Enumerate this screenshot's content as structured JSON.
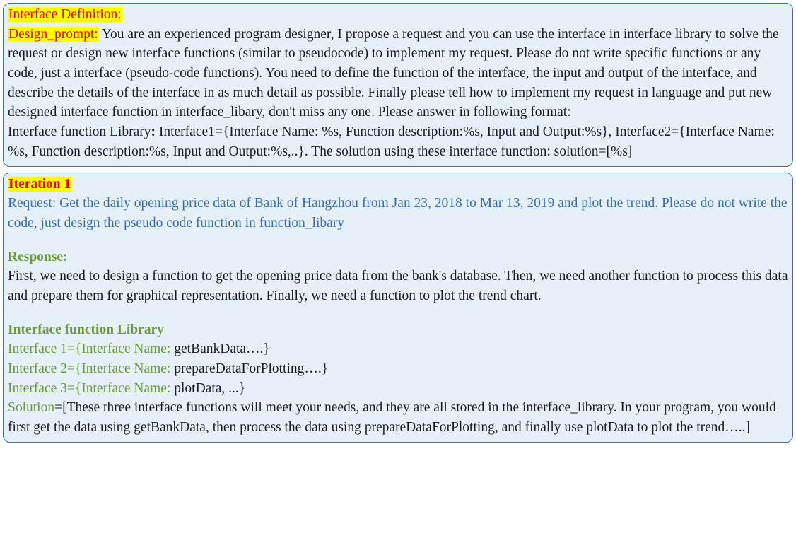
{
  "panel1": {
    "heading": "Interface Definition:",
    "design_prompt_label": "Design_prompt:",
    "design_prompt_text": " You are an experienced program designer, I propose a request and you can use the interface in interface library to solve the request or design new interface functions (similar to pseudocode) to implement my request. Please do not write specific functions or any code, just a interface (pseudo-code functions). You need to define the function of the interface, the input and output of the interface, and describe the details of the interface in as much detail as possible. Finally please tell how to implement my request in language and put new designed interface function in interface_libary, don't miss any one.  Please answer in following format:",
    "format_lead": "Interface function Library",
    "format_colon": ":",
    "format_rest": " Interface1={Interface Name:  %s, Function description:%s, Input and Output:%s}, Interface2={Interface Name:  %s, Function description:%s, Input and Output:%s,..}. The solution using these interface function: solution=[%s]"
  },
  "panel2": {
    "heading": "Iteration 1",
    "request_label": "Request: ",
    "request_text": "Get the daily opening price data of Bank of Hangzhou from Jan 23, 2018 to Mar 13, 2019 and plot the trend. Please do not write the code, just design the pseudo code function in function_libary",
    "response_label": "Response:",
    "response_text": "First, we need to design a function to get the opening price data from the bank's database. Then, we need another function to process this data and prepare them for graphical representation. Finally, we need a function to plot the trend chart.",
    "lib_label": "Interface function Library",
    "if1_lead": "Interface 1={Interface Name: ",
    "if1_rest": "getBankData….}",
    "if2_lead": "Interface 2={Interface Name: ",
    "if2_rest": "prepareDataForPlotting….}",
    "if3_lead": "Interface 3={Interface Name: ",
    "if3_rest": "plotData, ...}",
    "sol_lead": "Solution",
    "sol_rest": "=[These three interface functions will meet your needs, and they are all stored in the interface_library. In your program, you would first get the data using getBankData, then process the data using prepareDataForPlotting, and finally use plotData to plot the trend…..]"
  }
}
